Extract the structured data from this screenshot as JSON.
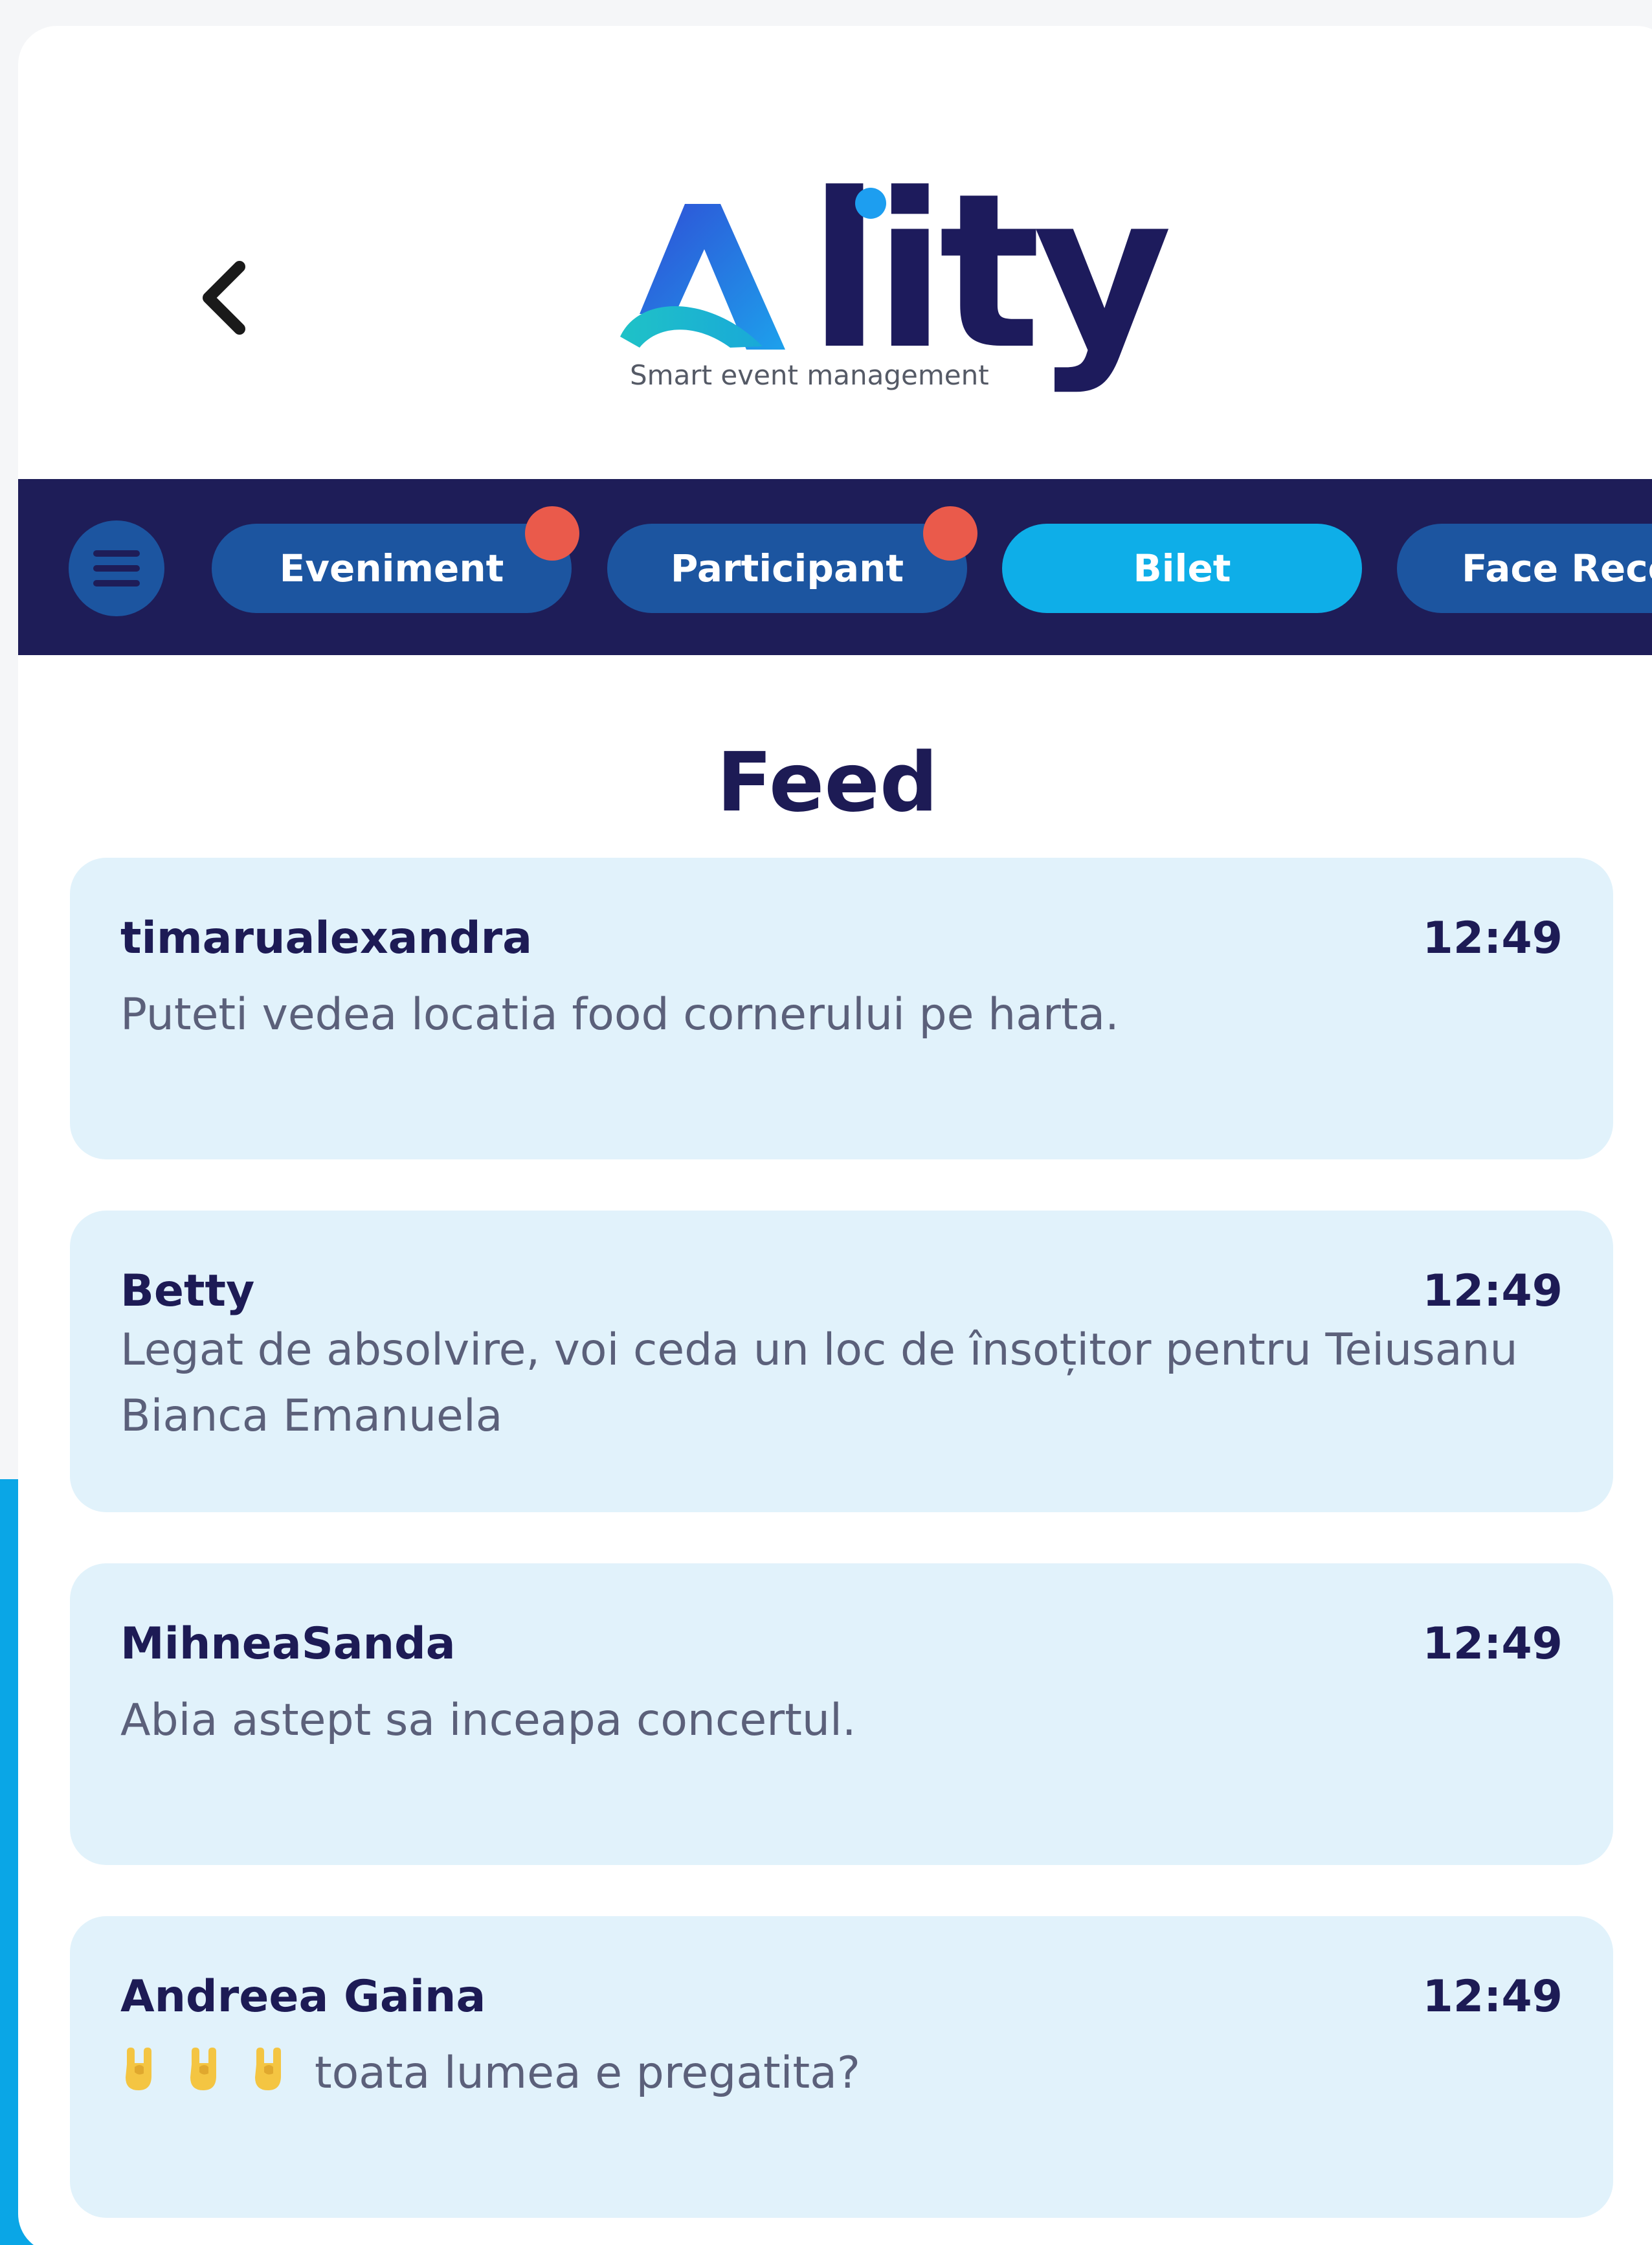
{
  "header": {
    "back_icon": "chevron-left-icon",
    "logo": {
      "word": "lity",
      "tagline": "Smart event management"
    }
  },
  "nav": {
    "menu_icon": "hamburger-icon",
    "tabs": [
      {
        "label": "Eveniment",
        "active": false,
        "has_badge": true
      },
      {
        "label": "Participant",
        "active": false,
        "has_badge": true
      },
      {
        "label": "Bilet",
        "active": true,
        "has_badge": false
      },
      {
        "label": "Face Reco",
        "active": false,
        "has_badge": false
      }
    ]
  },
  "feed": {
    "title": "Feed",
    "posts": [
      {
        "author": "timarualexandra",
        "time": "12:49",
        "message": "Puteti vedea locatia food cornerului pe harta."
      },
      {
        "author": "Betty",
        "time": "12:49",
        "message": "Legat de absolvire, voi ceda un loc de însoțitor pentru Teiusanu Bianca Emanuela"
      },
      {
        "author": "MihneaSanda",
        "time": "12:49",
        "message": "Abia astept sa inceapa concertul."
      },
      {
        "author": "Andreea Gaina",
        "time": "12:49",
        "message": "toata lumea e pregatita?",
        "emojis": [
          "rock-hand-emoji",
          "rock-hand-emoji",
          "rock-hand-emoji"
        ]
      }
    ]
  },
  "colors": {
    "navy": "#1e1d58",
    "pill": "#1c55a0",
    "active_pill": "#0eaee8",
    "badge": "#ea5a4b",
    "card": "#e1f2fb",
    "title_text": "#1d1b55",
    "body_text": "#5b607a"
  }
}
